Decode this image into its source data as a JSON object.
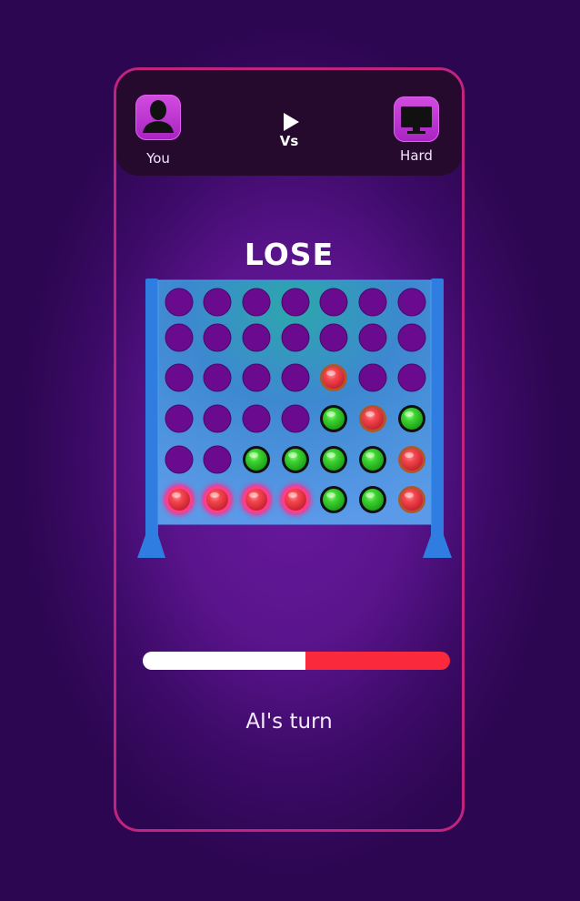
{
  "players": {
    "you": {
      "label": "You",
      "icon": "user-silhouette-icon"
    },
    "vs_label": "Vs",
    "vs_icon": "play-icon",
    "ai": {
      "label": "Hard",
      "icon": "monitor-icon"
    }
  },
  "result_text": "LOSE",
  "board": {
    "columns": 7,
    "rows": 6,
    "colors": {
      "red": "#f03a46",
      "green": "#2fcf2a",
      "win_glow": "#ff2a8a",
      "empty_hole": "#6a0a8e",
      "board_blue": "#3d8de8",
      "board_teal": "#24b0b0"
    },
    "grid": [
      [
        "",
        "",
        "",
        "",
        "",
        "",
        ""
      ],
      [
        "",
        "",
        "",
        "",
        "",
        "",
        ""
      ],
      [
        "",
        "",
        "",
        "",
        "red",
        "",
        ""
      ],
      [
        "",
        "",
        "",
        "",
        "green",
        "red",
        "green"
      ],
      [
        "",
        "",
        "green",
        "green",
        "green",
        "green",
        "red"
      ],
      [
        "red",
        "red",
        "red",
        "red",
        "green",
        "green",
        "red"
      ]
    ],
    "winning_cells": [
      [
        5,
        0
      ],
      [
        5,
        1
      ],
      [
        5,
        2
      ],
      [
        5,
        3
      ]
    ]
  },
  "progress": {
    "you_fraction": 0.53,
    "you_color": "#ffffff",
    "ai_color": "#fa2a3c"
  },
  "turn_text": "AI's turn"
}
